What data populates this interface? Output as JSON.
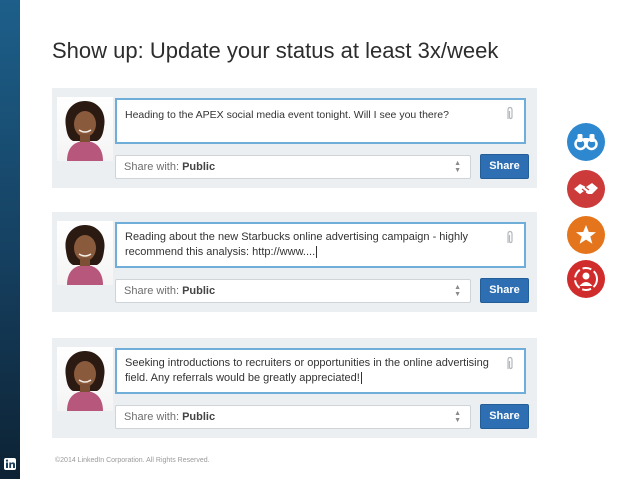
{
  "slide": {
    "title": "Show up: Update your status at least 3x/week",
    "copyright": "©2014 LinkedIn Corporation. All Rights Reserved."
  },
  "posts": [
    {
      "status_text": "Heading to the APEX social media event tonight. Will I see you there?",
      "share_prefix": "Share with:",
      "share_value": "Public",
      "share_button": "Share"
    },
    {
      "status_text": "Reading about the new Starbucks online advertising campaign - highly recommend this analysis: http://www....",
      "share_prefix": "Share with:",
      "share_value": "Public",
      "share_button": "Share"
    },
    {
      "status_text": "Seeking introductions to recruiters or opportunities in the online advertising field. Any referrals would be greatly appreciated!",
      "share_prefix": "Share with:",
      "share_value": "Public",
      "share_button": "Share"
    }
  ],
  "side_icons": [
    {
      "icon": "binoculars-icon",
      "color": "#2e88cf"
    },
    {
      "icon": "handshake-icon",
      "color": "#cc3a3a"
    },
    {
      "icon": "star-icon",
      "color": "#e5751d"
    },
    {
      "icon": "network-person-icon",
      "color": "#d12c2c"
    }
  ],
  "colors": {
    "linkedin_blue": "#2d6fb2",
    "left_bar": "#1d5f8a",
    "input_border": "#6faed8"
  }
}
